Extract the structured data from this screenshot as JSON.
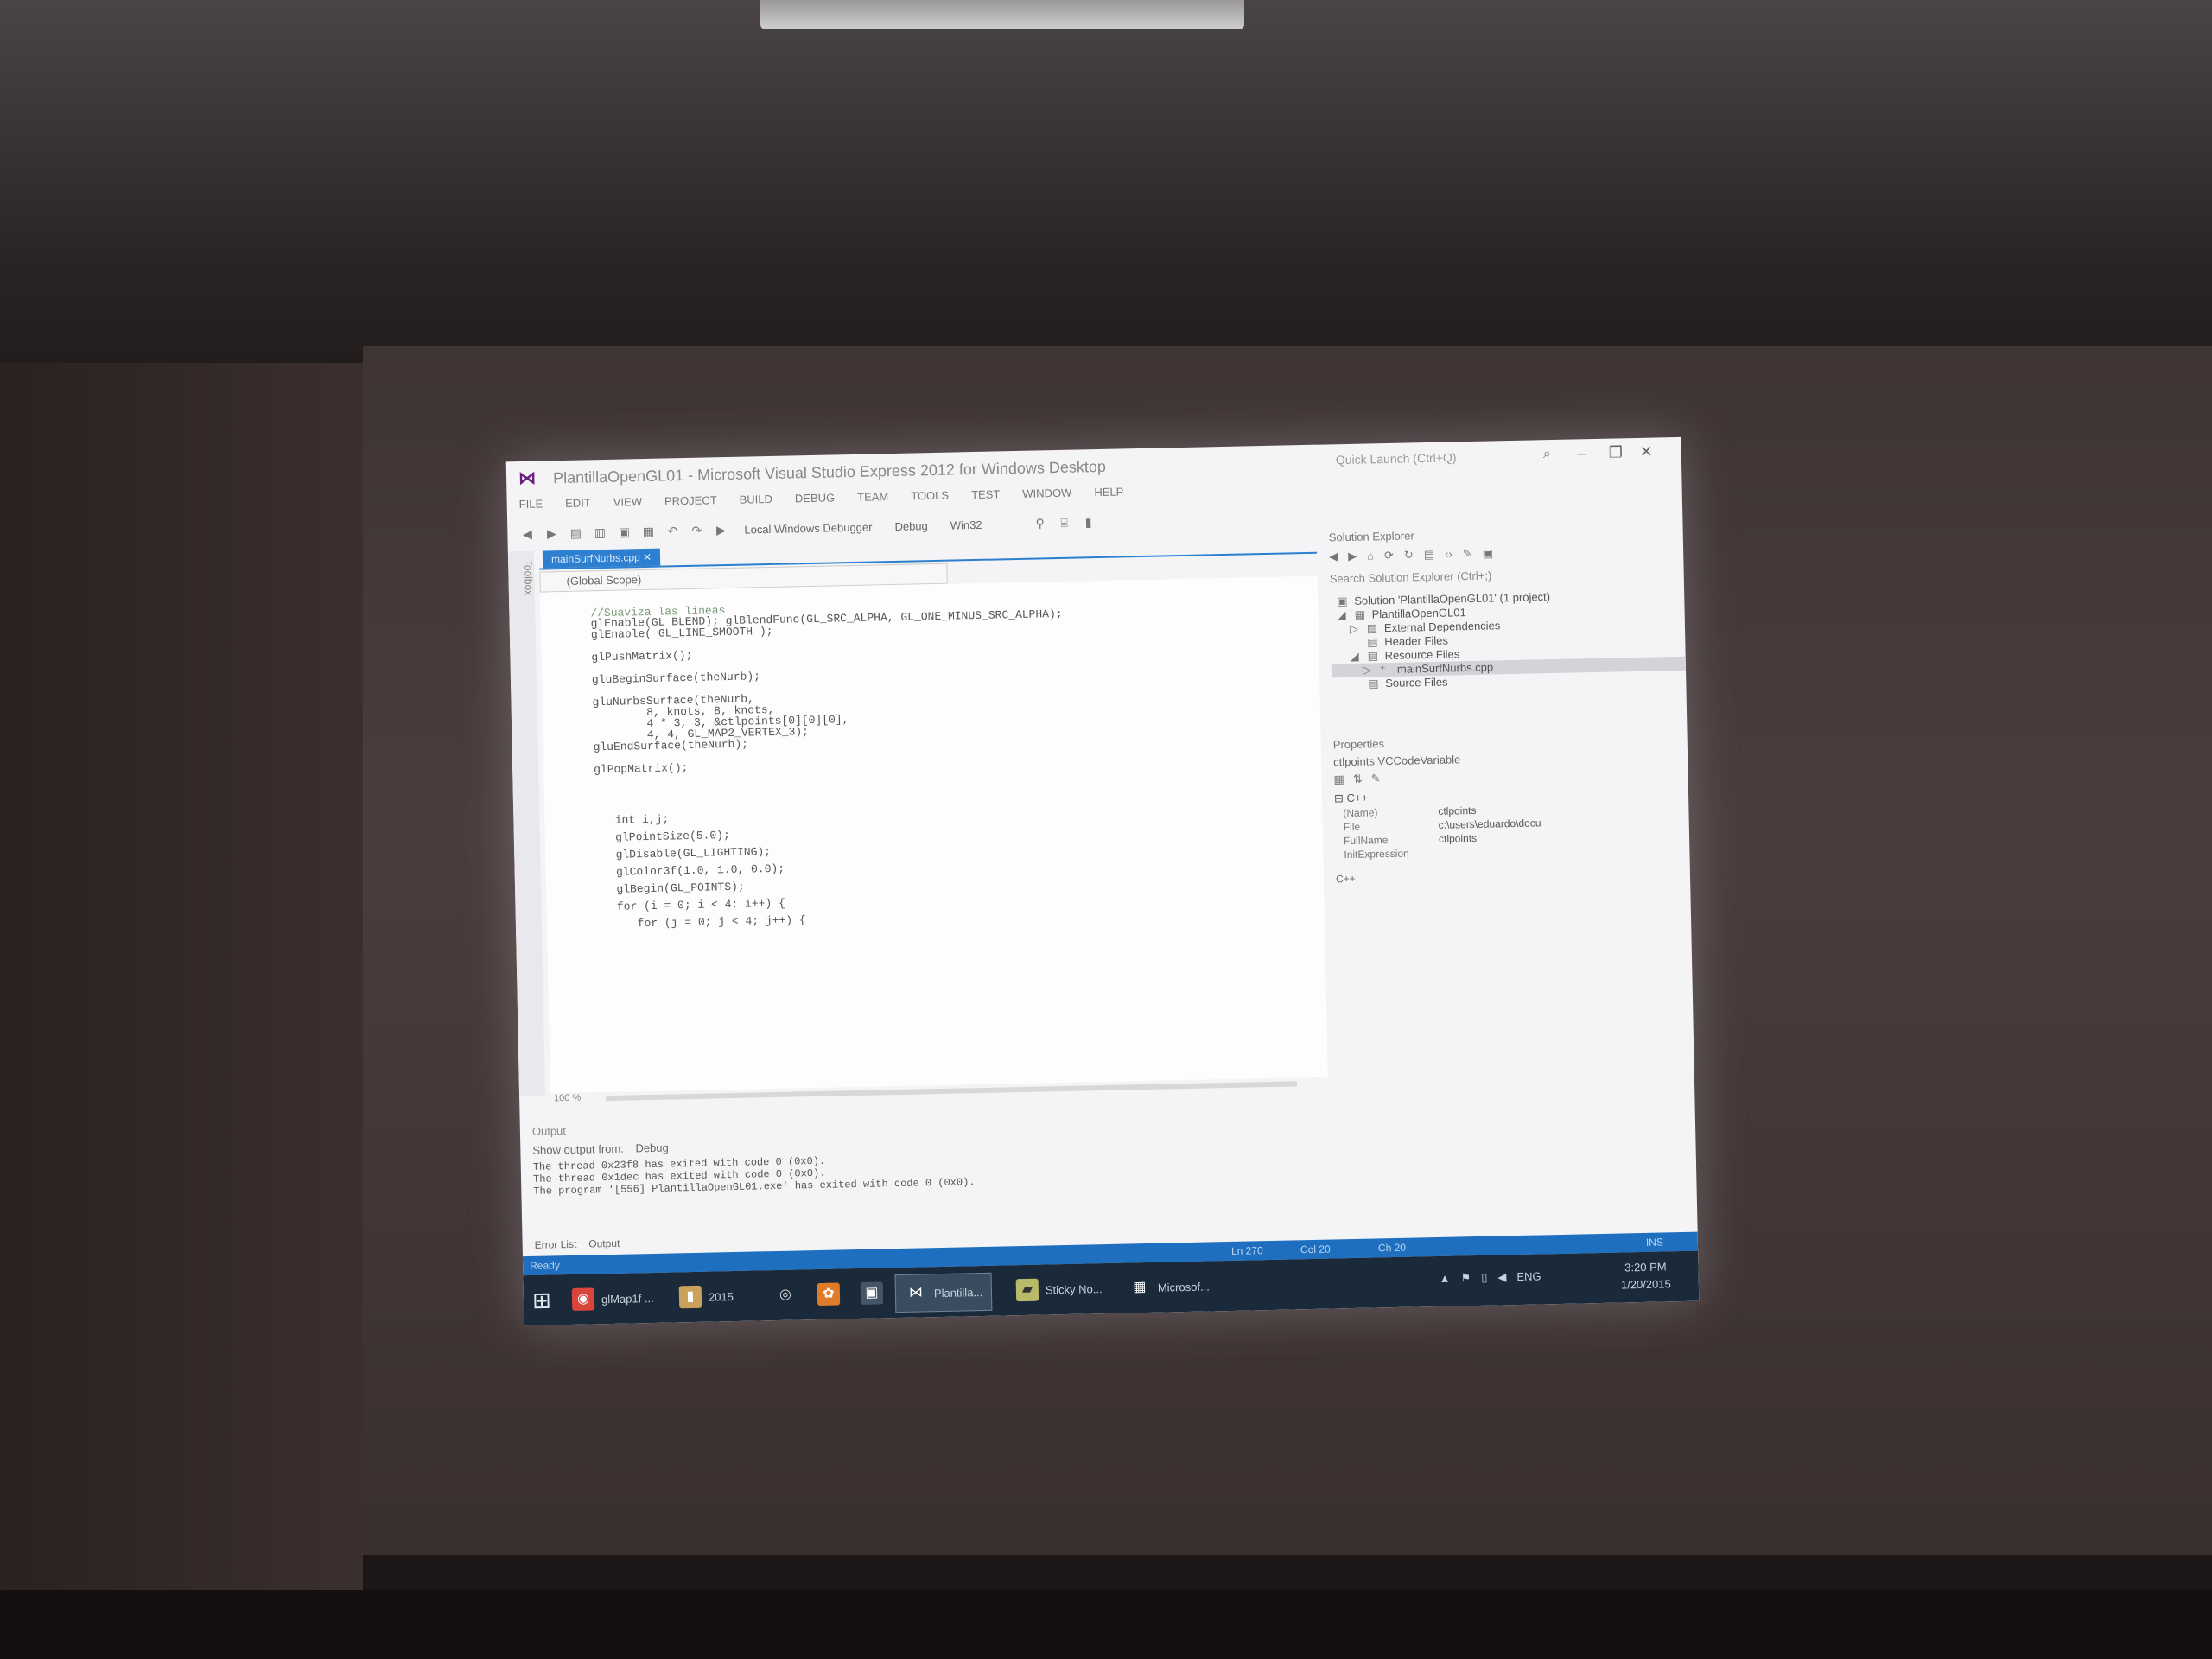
{
  "window": {
    "title": "PlantillaOpenGL01 - Microsoft Visual Studio Express 2012 for Windows Desktop",
    "quick_launch": "Quick Launch (Ctrl+Q)"
  },
  "menu": [
    "FILE",
    "EDIT",
    "VIEW",
    "PROJECT",
    "BUILD",
    "DEBUG",
    "TEAM",
    "TOOLS",
    "TEST",
    "WINDOW",
    "HELP"
  ],
  "toolbar": {
    "debugger": "Local Windows Debugger",
    "configuration": "Debug",
    "platform": "Win32"
  },
  "toolbox_label": "Toolbox",
  "editor": {
    "tab": "mainSurfNurbs.cpp",
    "scope": "(Global Scope)",
    "zoom": "100 %",
    "lines": [
      "//Suaviza las lineas",
      "glEnable(GL_BLEND); glBlendFunc(GL_SRC_ALPHA, GL_ONE_MINUS_SRC_ALPHA);",
      "glEnable( GL_LINE_SMOOTH );",
      "",
      "glPushMatrix();",
      "",
      "gluBeginSurface(theNurb);",
      "",
      "gluNurbsSurface(theNurb,",
      "        8, knots, 8, knots,",
      "        4 * 3, 3, &ctlpoints[0][0][0],",
      "        4, 4, GL_MAP2_VERTEX_3);",
      "gluEndSurface(theNurb);",
      "",
      "glPopMatrix();",
      "",
      "",
      "",
      "   int i,j;",
      "   glPointSize(5.0);",
      "   glDisable(GL_LIGHTING);",
      "   glColor3f(1.0, 1.0, 0.0);",
      "   glBegin(GL_POINTS);",
      "   for (i = 0; i < 4; i++) {",
      "      for (j = 0; j < 4; j++) {"
    ]
  },
  "solution_explorer": {
    "title": "Solution Explorer",
    "search_placeholder": "Search Solution Explorer (Ctrl+;)",
    "items": [
      "Solution 'PlantillaOpenGL01' (1 project)",
      "PlantillaOpenGL01",
      "External Dependencies",
      "Header Files",
      "Resource Files",
      "mainSurfNurbs.cpp",
      "Source Files"
    ]
  },
  "properties": {
    "title": "Properties",
    "object": "ctlpoints  VCCodeVariable",
    "category": "C++",
    "rows": [
      {
        "name": "(Name)",
        "value": "ctlpoints"
      },
      {
        "name": "File",
        "value": "c:\\users\\eduardo\\docu"
      },
      {
        "name": "FullName",
        "value": "ctlpoints"
      },
      {
        "name": "InitExpression",
        "value": ""
      }
    ],
    "description": "C++"
  },
  "output": {
    "title": "Output",
    "show_from_label": "Show output from:",
    "show_from_value": "Debug",
    "lines": [
      "The thread 0x23f8 has exited with code 0 (0x0).",
      "The thread 0x1dec has exited with code 0 (0x0).",
      "The program '[556] PlantillaOpenGL01.exe' has exited with code 0 (0x0)."
    ]
  },
  "bottom_tabs": [
    "Error List",
    "Output"
  ],
  "status": {
    "ready": "Ready",
    "ln": "Ln 270",
    "col": "Col 20",
    "ch": "Ch 20",
    "ins": "INS"
  },
  "taskbar": {
    "items": [
      "glMap1f ...",
      "2015",
      "Plantilla...",
      "Sticky No...",
      "Microsof..."
    ],
    "language": "ENG",
    "time": "3:20 PM",
    "date": "1/20/2015"
  }
}
